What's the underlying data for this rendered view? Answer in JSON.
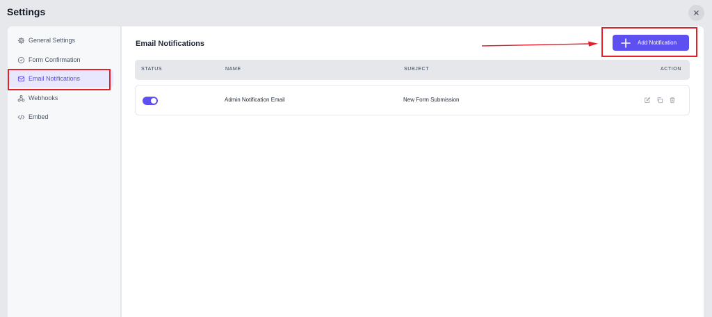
{
  "header": {
    "title": "Settings"
  },
  "sidebar": {
    "items": [
      {
        "label": "General Settings",
        "icon": "gear-icon"
      },
      {
        "label": "Form Confirmation",
        "icon": "check-circle-icon"
      },
      {
        "label": "Email Notifications",
        "icon": "envelope-icon",
        "active": true
      },
      {
        "label": "Webhooks",
        "icon": "webhook-icon"
      },
      {
        "label": "Embed",
        "icon": "code-icon"
      }
    ]
  },
  "main": {
    "title": "Email Notifications",
    "add_button_label": "Add Notification",
    "table": {
      "columns": [
        "STATUS",
        "NAME",
        "SUBJECT",
        "ACTION"
      ],
      "rows": [
        {
          "status": "on",
          "name": "Admin Notification Email",
          "subject": "New Form Submission"
        }
      ]
    }
  },
  "colors": {
    "accent": "#5d4ff0",
    "annotation": "#e4202b"
  }
}
